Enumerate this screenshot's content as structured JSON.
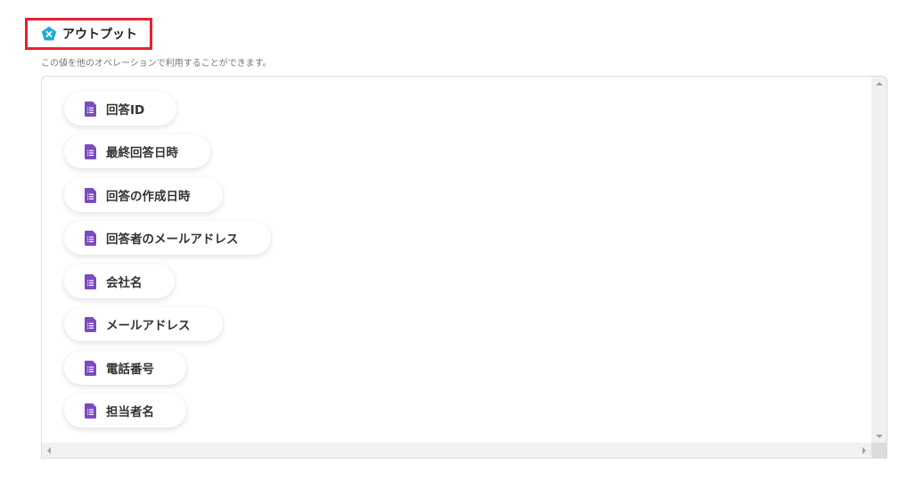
{
  "section": {
    "title": "アウトプット",
    "description": "この値を他のオペレーションで利用することができます。",
    "icon": "x-pentagon-icon",
    "icon_color": "#1fa9d6",
    "highlight_color": "#e8212d"
  },
  "outputs": [
    {
      "label": "回答ID",
      "icon": "google-forms-icon"
    },
    {
      "label": "最終回答日時",
      "icon": "google-forms-icon"
    },
    {
      "label": "回答の作成日時",
      "icon": "google-forms-icon"
    },
    {
      "label": "回答者のメールアドレス",
      "icon": "google-forms-icon"
    },
    {
      "label": "会社名",
      "icon": "google-forms-icon"
    },
    {
      "label": "メールアドレス",
      "icon": "google-forms-icon"
    },
    {
      "label": "電話番号",
      "icon": "google-forms-icon"
    },
    {
      "label": "担当者名",
      "icon": "google-forms-icon"
    }
  ],
  "form_icon_color": "#7b4bc0"
}
